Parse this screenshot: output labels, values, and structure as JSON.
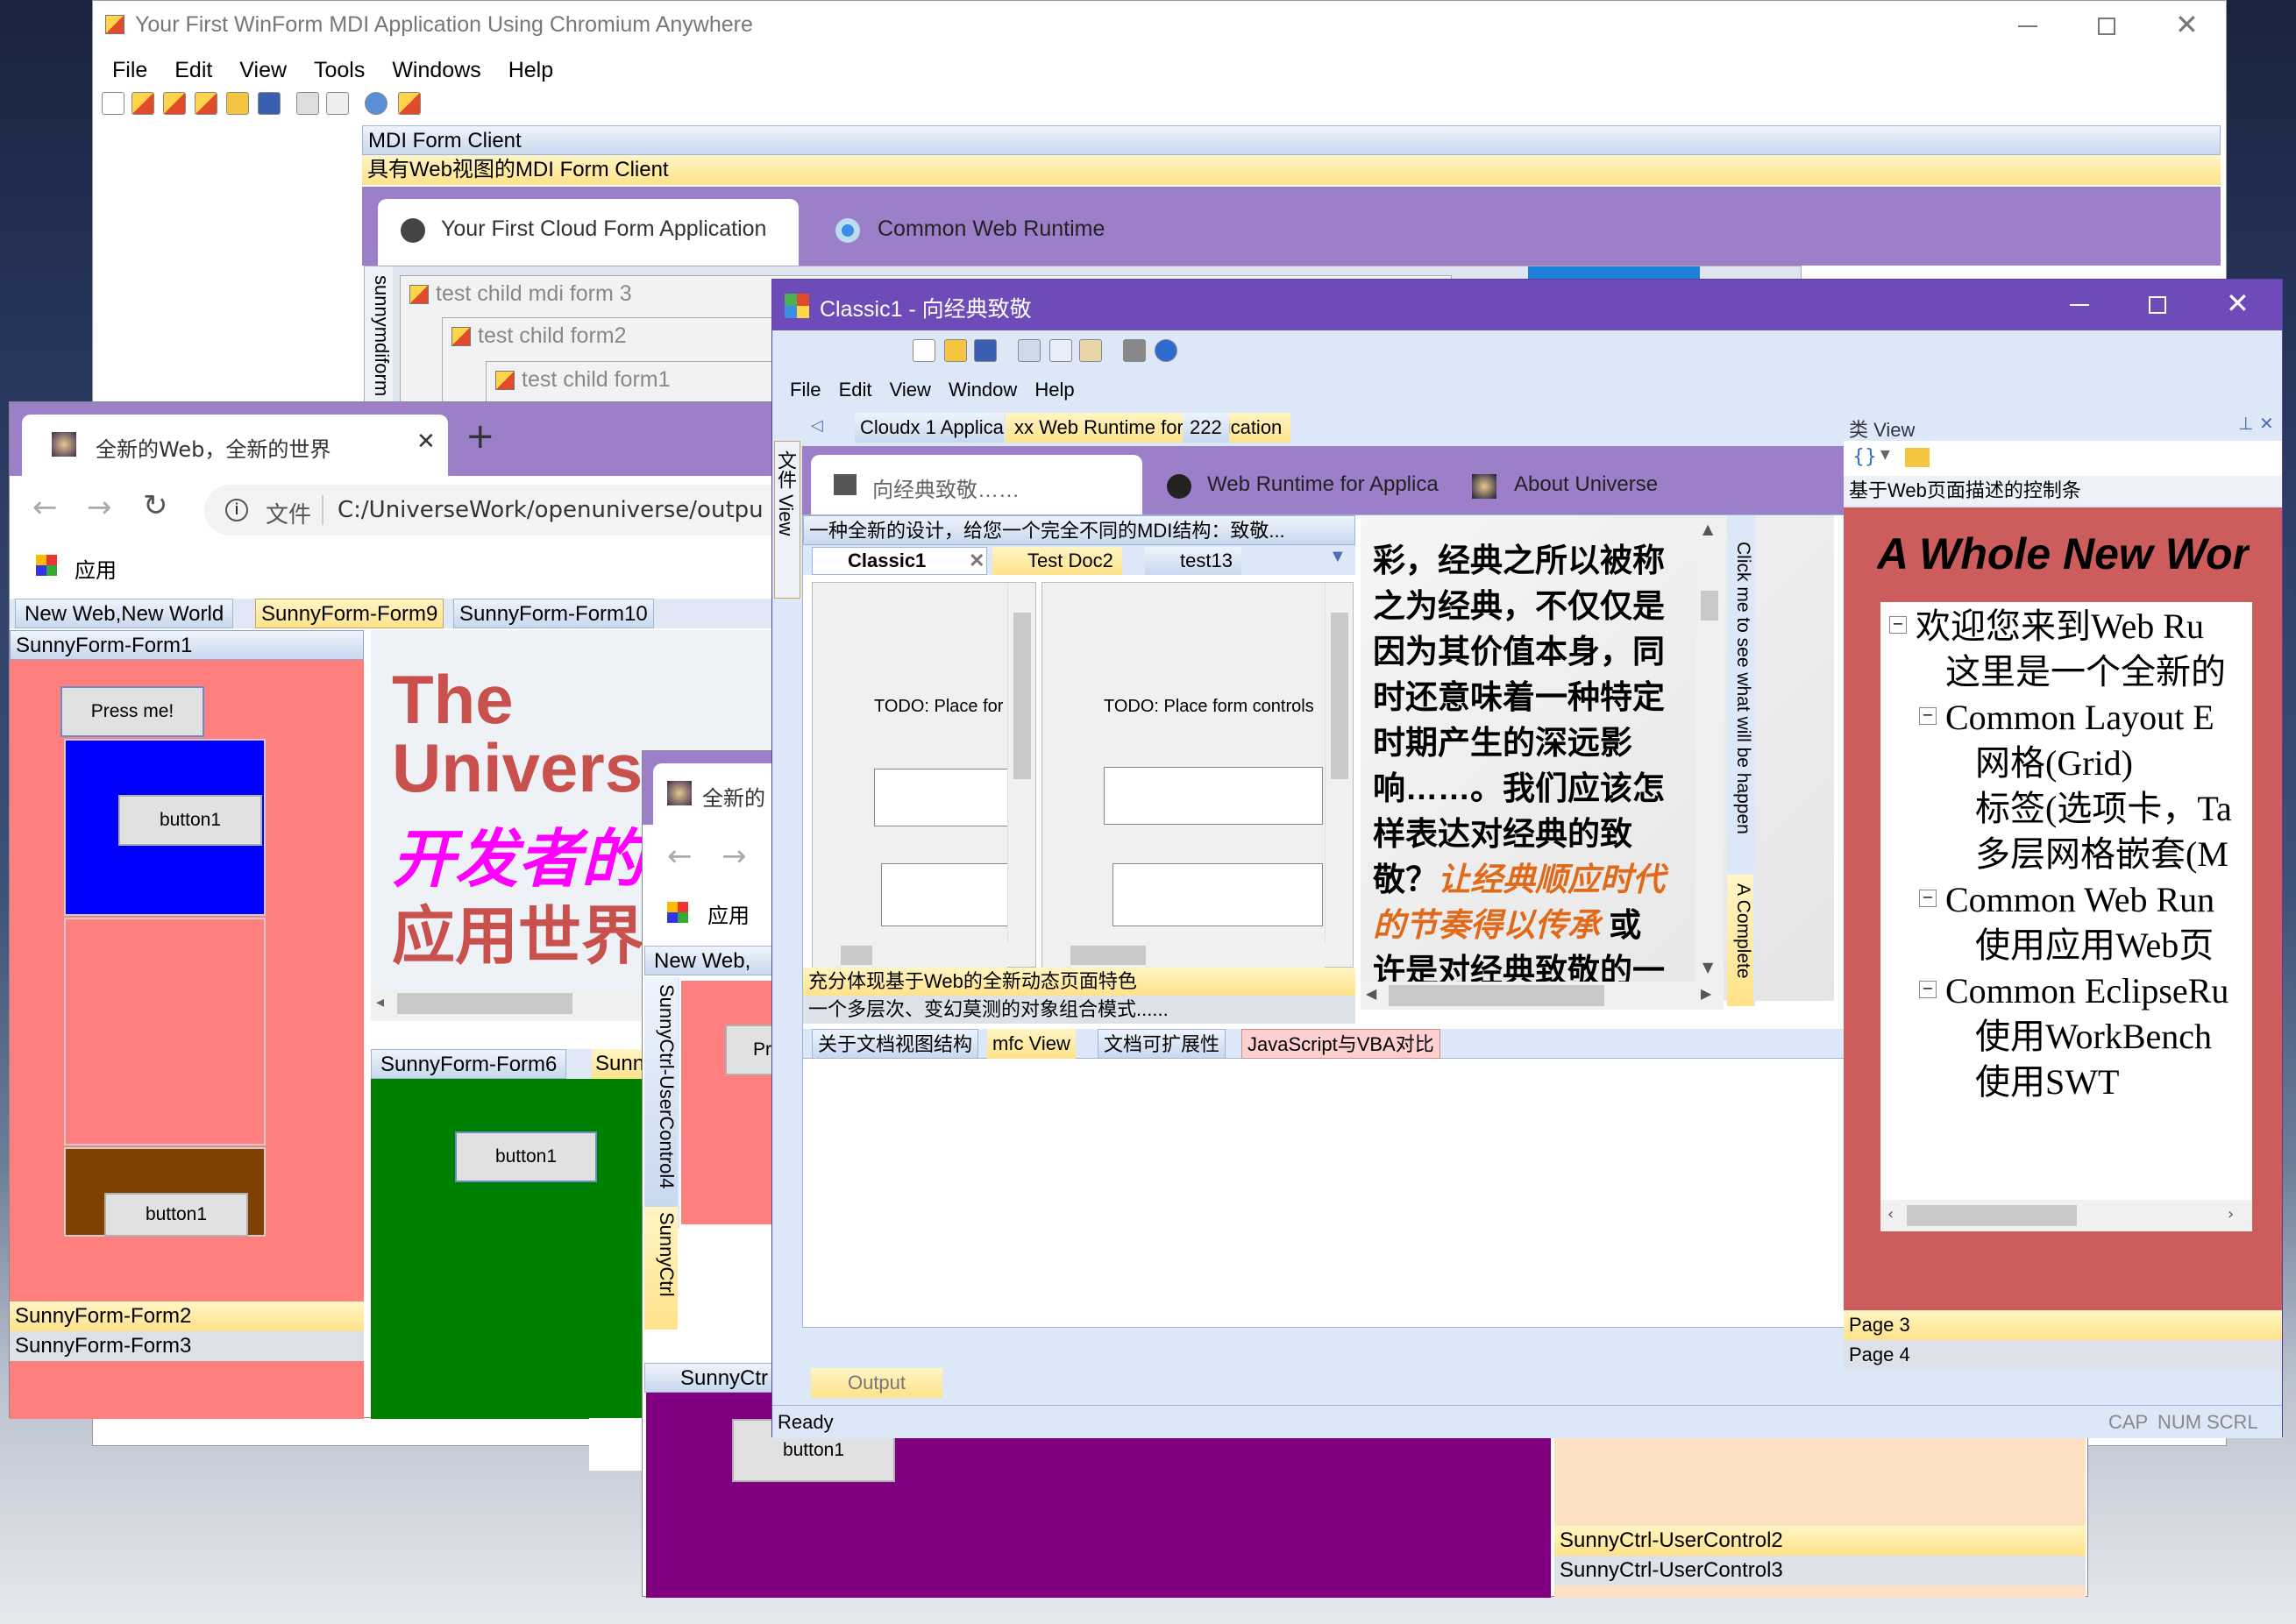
{
  "main": {
    "title": "Your First WinForm MDI Application Using Chromium Anywhere",
    "menu": [
      "File",
      "Edit",
      "View",
      "Tools",
      "Windows",
      "Help"
    ],
    "mdi_header": "MDI Form Client",
    "mdi_subheader": "具有Web视图的MDI Form Client",
    "tabs": [
      "Your First Cloud Form Application",
      "Common Web Runtime"
    ],
    "side_vertical": "sunnymdiform",
    "children": [
      "test child mdi form 3",
      "test child form2",
      "test child form1"
    ]
  },
  "browser": {
    "tab_title": "全新的Web，全新的世界",
    "url_label": "文件",
    "url": "C:/UniverseWork/openuniverse/outpu",
    "apps": "应用",
    "form_tabs": [
      "New Web,New World",
      "SunnyForm-Form9",
      "SunnyForm-Form10"
    ],
    "form1": "SunnyForm-Form1",
    "press_btn": "Press me!",
    "button1": "button1",
    "form2": "SunnyForm-Form2",
    "form3": "SunnyForm-Form3",
    "hero": [
      "The",
      "Univers",
      "开发者的",
      "应用世界"
    ],
    "form6_tabs": [
      "SunnyForm-Form6",
      "Sunn"
    ]
  },
  "browser2": {
    "tab_title": "全新的",
    "apps": "应用",
    "tab": "New Web,",
    "press": "Pre",
    "vertical_tabs": [
      "SunnyCtrl-UserControl4",
      "SunnyCtrl"
    ],
    "bottom_tab": "SunnyCtr",
    "button1": "button1",
    "ctrl2": "SunnyCtrl-UserControl2",
    "ctrl3": "SunnyCtrl-UserControl3"
  },
  "classic": {
    "title": "Classic1 - 向经典致敬",
    "menu": [
      "File",
      "Edit",
      "View",
      "Window",
      "Help"
    ],
    "side_vertical": "文件 View",
    "doc_tabs": [
      "Cloudx 1 Application",
      "xx Web Runtime for Application",
      "222"
    ],
    "web_tabs": [
      "向经典致敬……",
      "Web Runtime for Applica",
      "About Universe"
    ],
    "header_text": "一种全新的设计，给您一个完全不同的MDI结构：致敬...",
    "inner_tabs": [
      "Classic1",
      "Test Doc2",
      "test13"
    ],
    "todo": "TODO: Place for",
    "todo2": "TODO: Place form controls",
    "article_lines": [
      "彩，经典之所以被称",
      "之为经典，不仅仅是",
      "因为其价值本身，同",
      "时还意味着一种特定",
      "时期产生的深远影",
      "响……。我们应该怎",
      "样表达对经典的致",
      "敬？",
      "让经典顺应时代",
      "的节奏得以传承",
      "或",
      "许是对经典致敬的一"
    ],
    "footer1": "充分体现基于Web的全新动态页面特色",
    "footer2": "一个多层次、变幻莫测的对象组合模式......",
    "vertical_right": [
      "Click me to see what will be happen",
      "A Complete"
    ],
    "bottom_tabs": [
      "关于文档视图结构",
      "mfc View",
      "文档可扩展性",
      "JavaScript与VBA对比"
    ],
    "output": "Output",
    "status": "Ready",
    "indicators": [
      "CAP",
      "NUM",
      "SCRL"
    ]
  },
  "class_view": {
    "title": "类 View",
    "desc": "基于Web页面描述的控制条",
    "heading": "A Whole New Wor",
    "tree": [
      {
        "text": "欢迎您来到Web Ru",
        "level": 0,
        "toggle": true
      },
      {
        "text": "这里是一个全新的",
        "level": 1,
        "toggle": false
      },
      {
        "text": "Common Layout E",
        "level": 1,
        "toggle": true
      },
      {
        "text": "网格(Grid)",
        "level": 2,
        "toggle": false
      },
      {
        "text": "标签(选项卡，Ta",
        "level": 2,
        "toggle": false
      },
      {
        "text": "多层网格嵌套(M",
        "level": 2,
        "toggle": false
      },
      {
        "text": "Common Web Run",
        "level": 1,
        "toggle": true
      },
      {
        "text": "使用应用Web页",
        "level": 2,
        "toggle": false
      },
      {
        "text": "Common EclipseRu",
        "level": 1,
        "toggle": true
      },
      {
        "text": "使用WorkBench",
        "level": 2,
        "toggle": false
      },
      {
        "text": "使用SWT",
        "level": 2,
        "toggle": false
      }
    ],
    "pages": [
      "Page 3",
      "Page 4"
    ]
  },
  "colors": {
    "accent_purple": "#9b7fc9",
    "tab_yellow": "#ffe28a",
    "salmon": "#ff7f7f",
    "green": "#008000",
    "purple": "#800080",
    "blue": "#0000ff",
    "brown": "#804000"
  }
}
